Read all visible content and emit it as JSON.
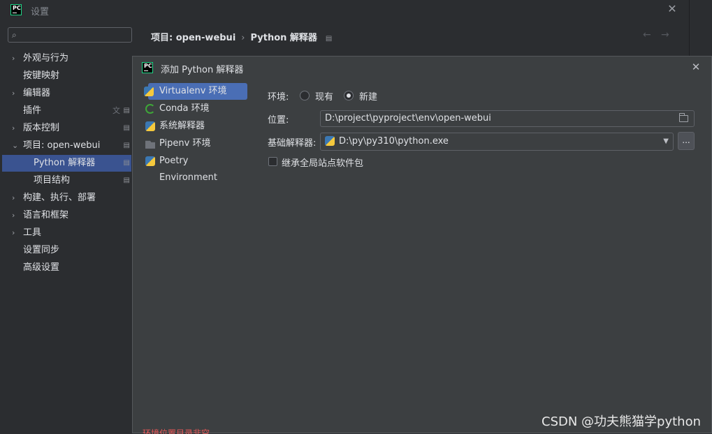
{
  "window": {
    "title": "设置",
    "close": "✕"
  },
  "sidebar": {
    "search_placeholder": "",
    "items": [
      {
        "label": "外观与行为",
        "chevron": "›"
      },
      {
        "label": "按键映射",
        "chevron": ""
      },
      {
        "label": "编辑器",
        "chevron": "›"
      },
      {
        "label": "插件",
        "chevron": ""
      },
      {
        "label": "版本控制",
        "chevron": "›"
      },
      {
        "label": "项目: open-webui",
        "chevron": "⌄"
      },
      {
        "label": "Python 解释器",
        "chevron": ""
      },
      {
        "label": "项目结构",
        "chevron": ""
      },
      {
        "label": "构建、执行、部署",
        "chevron": "›"
      },
      {
        "label": "语言和框架",
        "chevron": "›"
      },
      {
        "label": "工具",
        "chevron": "›"
      },
      {
        "label": "设置同步",
        "chevron": ""
      },
      {
        "label": "高级设置",
        "chevron": ""
      }
    ]
  },
  "header": {
    "breadcrumb_project": "项目: open-webui",
    "breadcrumb_sep": "›",
    "breadcrumb_page": "Python 解释器",
    "back": "←",
    "forward": "→"
  },
  "dialog": {
    "title": "添加 Python 解释器",
    "close": "✕",
    "env_types": [
      {
        "label": "Virtualenv 环境",
        "icon": "python-icon"
      },
      {
        "label": "Conda 环境",
        "icon": "conda-icon"
      },
      {
        "label": "系统解释器",
        "icon": "python-icon"
      },
      {
        "label": "Pipenv 环境",
        "icon": "pipenv-icon"
      },
      {
        "label": "Poetry Environment",
        "icon": "poetry-icon"
      }
    ],
    "env_label": "环境:",
    "env_options": [
      "现有",
      "新建"
    ],
    "env_selected": "新建",
    "location_label": "位置:",
    "location_value": "D:\\project\\pyproject\\env\\open-webui",
    "base_label": "基础解释器:",
    "base_value": "D:\\py\\py310\\python.exe",
    "browse": "...",
    "inherit_label": "继承全局站点软件包",
    "inherit_checked": false,
    "error": "环境位置目录非空"
  },
  "watermark": "CSDN @功夫熊猫学python",
  "colors": {
    "selection": "#3a5390",
    "dialog_selection": "#4a6eb5",
    "error": "#e55757"
  }
}
